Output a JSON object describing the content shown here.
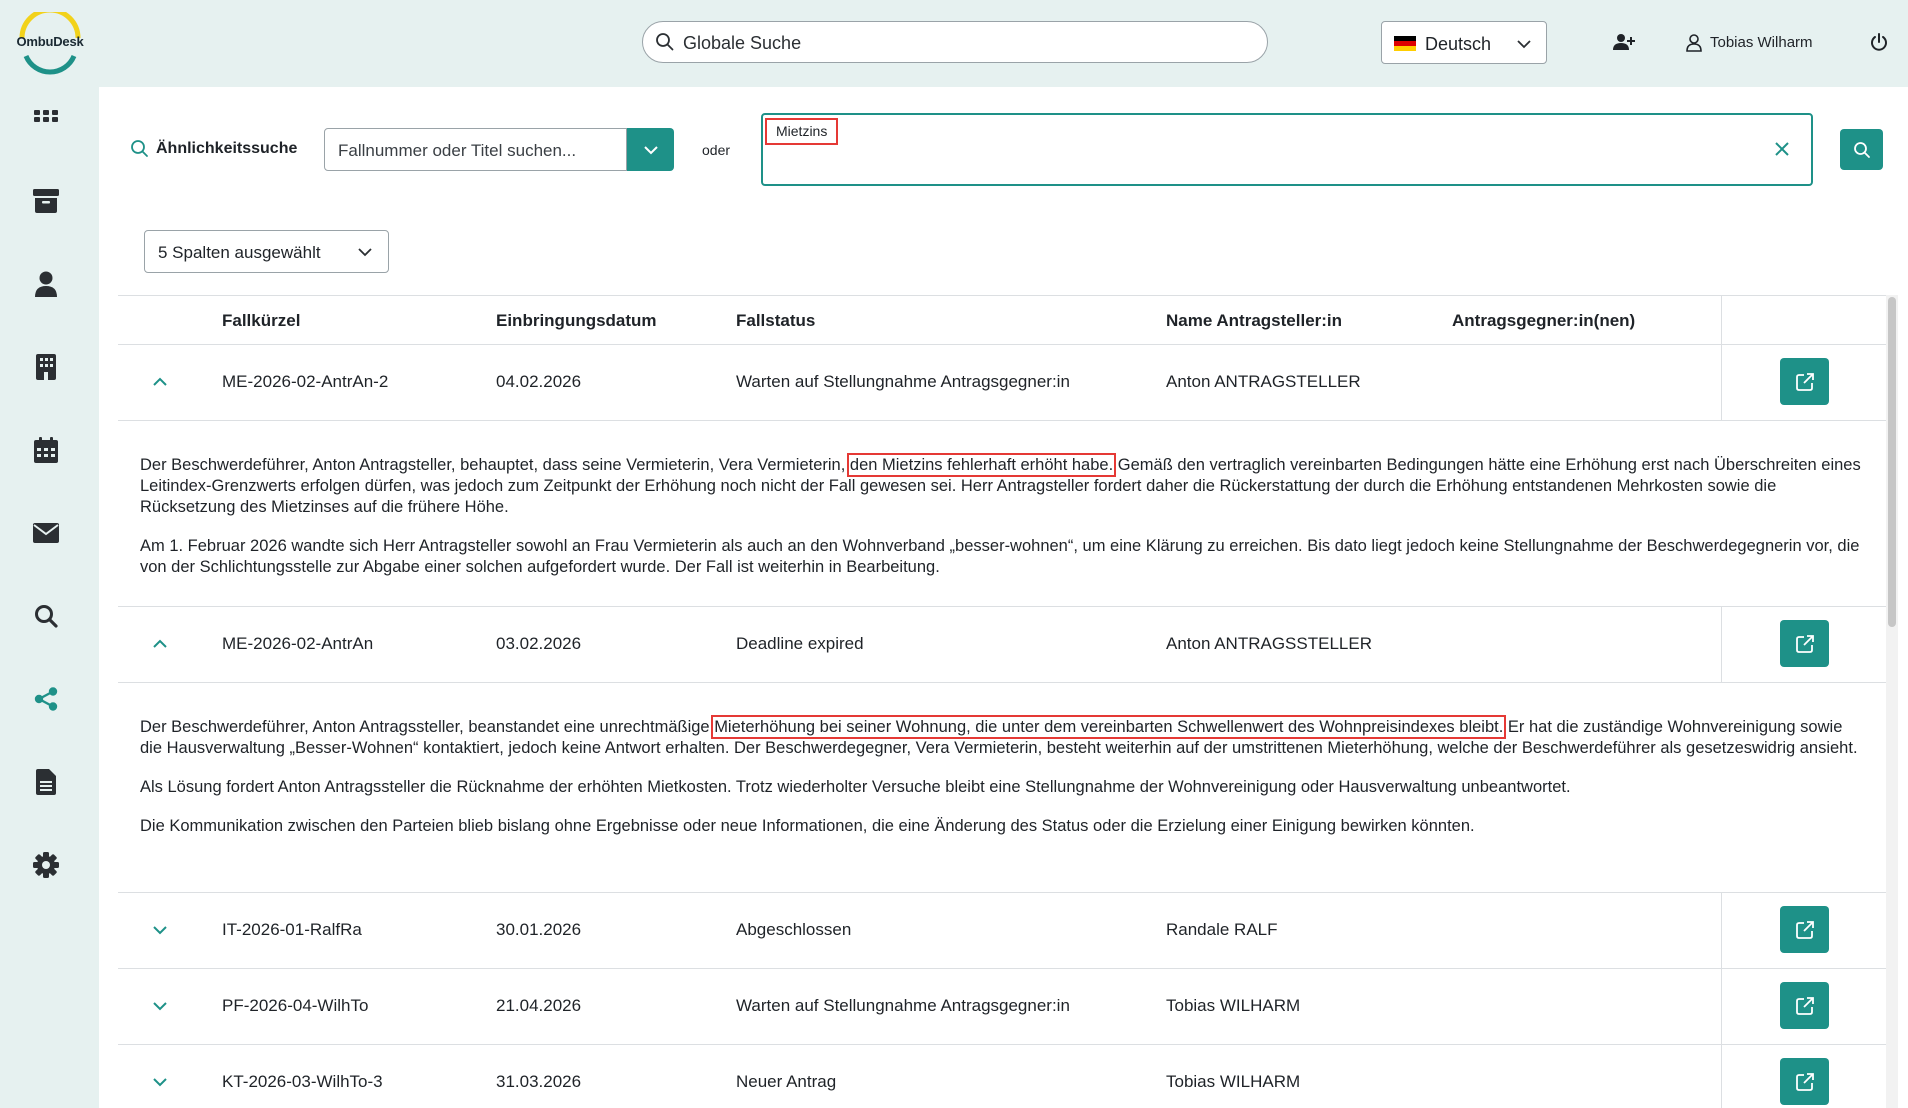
{
  "header": {
    "logo_text": "OmbuDesk",
    "search_placeholder": "Globale Suche",
    "language": "Deutsch",
    "user_name": "Tobias Wilharm"
  },
  "sidebar": {
    "items": [
      {
        "name": "dashboard",
        "icon": "grid-icon"
      },
      {
        "name": "archive",
        "icon": "archive-icon"
      },
      {
        "name": "persons",
        "icon": "person-icon"
      },
      {
        "name": "organizations",
        "icon": "building-icon"
      },
      {
        "name": "calendar",
        "icon": "calendar-icon"
      },
      {
        "name": "messages",
        "icon": "mail-icon"
      },
      {
        "name": "search",
        "icon": "search-icon"
      },
      {
        "name": "similarity",
        "icon": "share-icon",
        "active": true
      },
      {
        "name": "documents",
        "icon": "document-icon"
      },
      {
        "name": "settings",
        "icon": "gear-icon"
      }
    ]
  },
  "filter": {
    "similarity_label": "Ähnlichkeitssuche",
    "case_placeholder": "Fallnummer oder Titel suchen...",
    "or_label": "oder",
    "search_tag": "Mietzins",
    "columns_label": "5 Spalten ausgewählt"
  },
  "table": {
    "columns": [
      "Fallkürzel",
      "Einbringungsdatum",
      "Fallstatus",
      "Name Antragsteller:in",
      "Antragsgegner:in(nen)"
    ],
    "rows": [
      {
        "id": "ME-2026-02-AntrAn-2",
        "date": "04.02.2026",
        "status": "Warten auf Stellungnahme Antragsgegner:in",
        "applicant": "Anton ANTRAGSTELLER",
        "opponent": "",
        "expanded": true,
        "p1_before": "Der Beschwerdeführer, Anton Antragsteller, behauptet, dass seine Vermieterin, Vera Vermieterin, ",
        "p1_highlight": "den Mietzins fehlerhaft erhöht habe.",
        "p1_after": " Gemäß den vertraglich vereinbarten Bedingungen hätte eine Erhöhung erst nach Überschreiten eines Leitindex-Grenzwerts erfolgen dürfen, was jedoch zum Zeitpunkt der Erhöhung noch nicht der Fall gewesen sei. Herr Antragsteller fordert daher die Rückerstattung der durch die Erhöhung entstandenen Mehrkosten sowie die Rücksetzung des Mietzinses auf die frühere Höhe.",
        "p2": "Am 1. Februar 2026 wandte sich Herr Antragsteller sowohl an Frau Vermieterin als auch an den Wohnverband „besser-wohnen“, um eine Klärung zu erreichen. Bis dato liegt jedoch keine Stellungnahme der Beschwerdegegnerin vor, die von der Schlichtungsstelle zur Abgabe einer solchen aufgefordert wurde. Der Fall ist weiterhin in Bearbeitung."
      },
      {
        "id": "ME-2026-02-AntrAn",
        "date": "03.02.2026",
        "status": "Deadline expired",
        "applicant": "Anton ANTRAGSSTELLER",
        "opponent": "",
        "expanded": true,
        "p1_before": "Der Beschwerdeführer, Anton Antragssteller, beanstandet eine unrechtmäßige ",
        "p1_highlight": "Mieterhöhung bei seiner Wohnung, die unter dem vereinbarten Schwellenwert des Wohnpreisindexes bleibt.",
        "p1_after": " Er hat die zuständige Wohnvereinigung sowie die Hausverwaltung „Besser-Wohnen“ kontaktiert, jedoch keine Antwort erhalten. Der Beschwerdegegner, Vera Vermieterin, besteht weiterhin auf der umstrittenen Mieterhöhung, welche der Beschwerdeführer als gesetzeswidrig ansieht.",
        "p2": "Als Lösung fordert Anton Antragssteller die Rücknahme der erhöhten Mietkosten. Trotz wiederholter Versuche bleibt eine Stellungnahme der Wohnvereinigung oder Hausverwaltung unbeantwortet.",
        "p3": "Die Kommunikation zwischen den Parteien blieb bislang ohne Ergebnisse oder neue Informationen, die eine Änderung des Status oder die Erzielung einer Einigung bewirken könnten."
      },
      {
        "id": "IT-2026-01-RalfRa",
        "date": "30.01.2026",
        "status": "Abgeschlossen",
        "applicant": "Randale RALF",
        "opponent": "",
        "expanded": false
      },
      {
        "id": "PF-2026-04-WilhTo",
        "date": "21.04.2026",
        "status": "Warten auf Stellungnahme Antragsgegner:in",
        "applicant": "Tobias WILHARM",
        "opponent": "",
        "expanded": false
      },
      {
        "id": "KT-2026-03-WilhTo-3",
        "date": "31.03.2026",
        "status": "Neuer Antrag",
        "applicant": "Tobias WILHARM",
        "opponent": "",
        "expanded": false
      }
    ]
  },
  "colors": {
    "accent": "#1e9188",
    "header_bg": "#e6f1f0",
    "highlight": "#e53935"
  }
}
